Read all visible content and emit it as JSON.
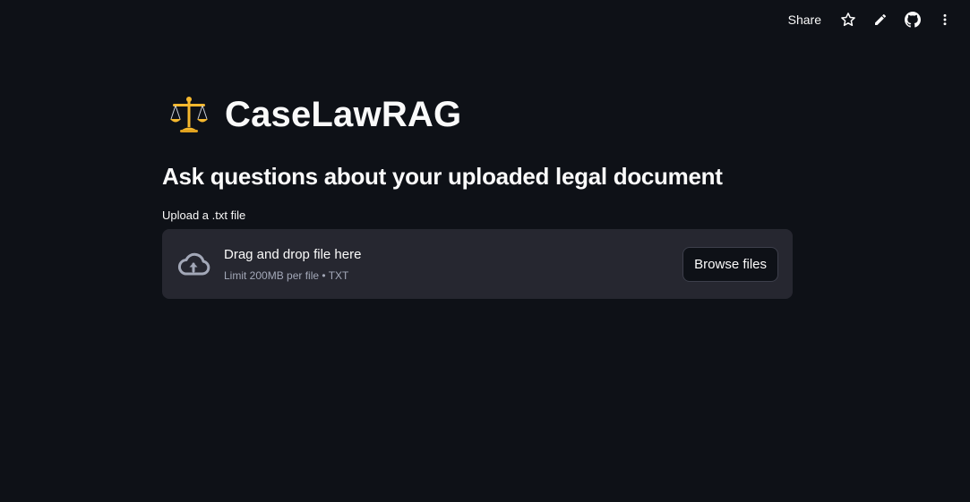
{
  "toolbar": {
    "share_label": "Share",
    "icons": [
      "star-icon",
      "edit-pencil-icon",
      "github-icon",
      "more-vert-icon"
    ]
  },
  "header": {
    "emoji": "balance-scale-icon",
    "title": "CaseLawRAG"
  },
  "main": {
    "subtitle": "Ask questions about your uploaded legal document"
  },
  "uploader": {
    "label": "Upload a .txt file",
    "drop_text": "Drag and drop file here",
    "limit_text": "Limit 200MB per file • TXT",
    "browse_label": "Browse files",
    "icon": "cloud-upload-icon"
  },
  "colors": {
    "background": "#0e1117",
    "dropzone": "#262730",
    "text": "#fafafa",
    "muted": "#a3a8b8",
    "accent_gold": "#f5b82e"
  }
}
